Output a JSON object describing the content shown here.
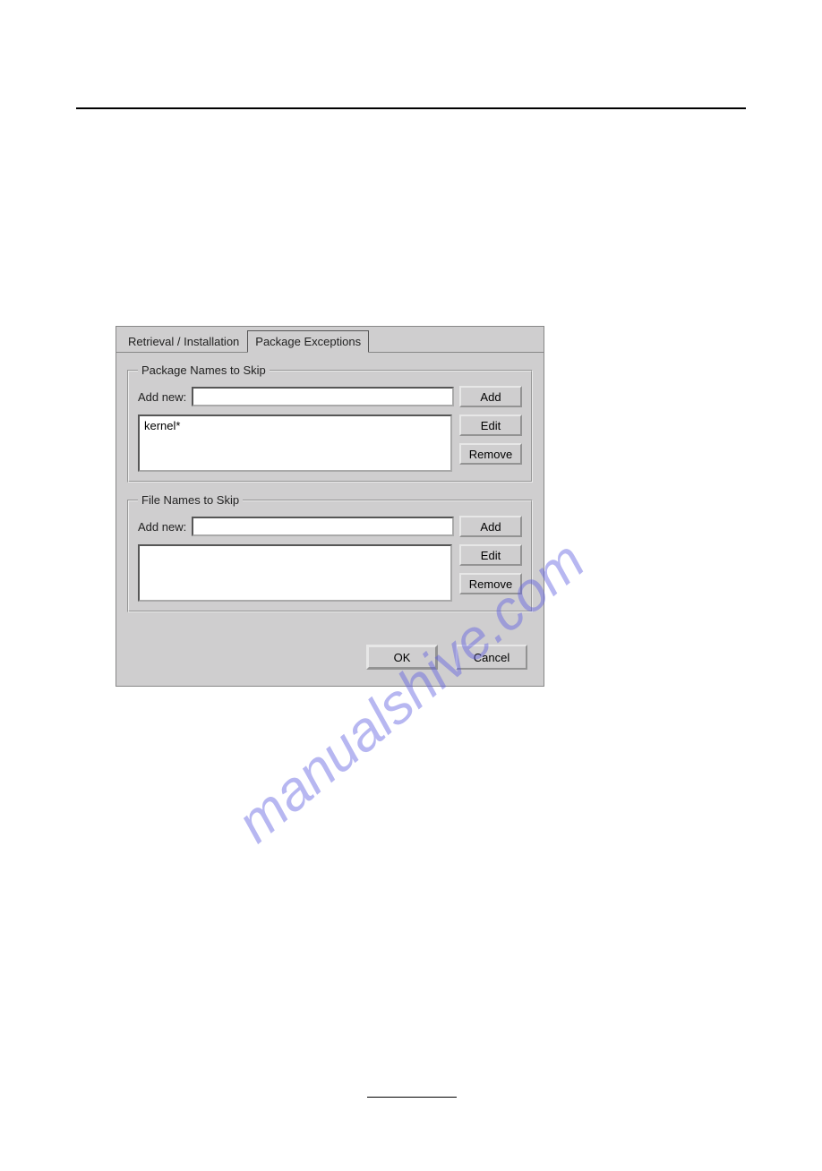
{
  "tabs": {
    "retrieval": "Retrieval / Installation",
    "exceptions": "Package Exceptions"
  },
  "groups": {
    "packages": {
      "legend": "Package Names to Skip",
      "addLabel": "Add new:",
      "addValue": "",
      "addBtn": "Add",
      "editBtn": "Edit",
      "removeBtn": "Remove",
      "items": [
        "kernel*"
      ]
    },
    "files": {
      "legend": "File Names to Skip",
      "addLabel": "Add new:",
      "addValue": "",
      "addBtn": "Add",
      "editBtn": "Edit",
      "removeBtn": "Remove",
      "items": []
    }
  },
  "footer": {
    "ok": "OK",
    "cancel": "Cancel"
  },
  "watermark": "manualshive.com"
}
